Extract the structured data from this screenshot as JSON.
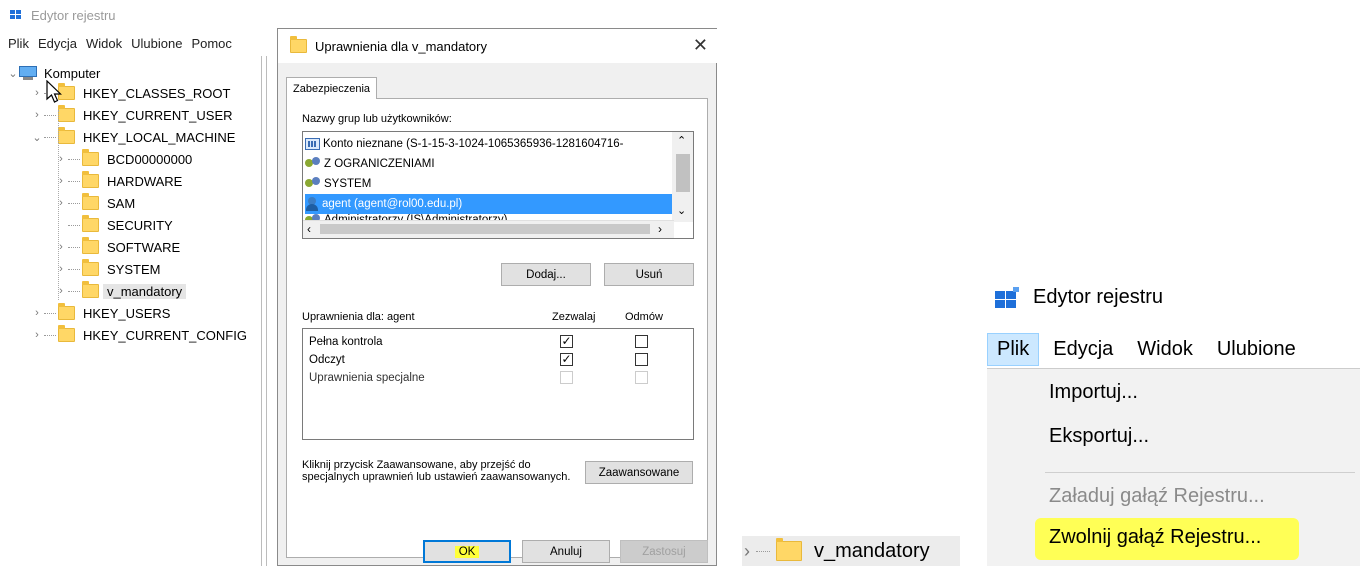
{
  "registry": {
    "title": "Edytor rejestru",
    "menu": [
      "Plik",
      "Edycja",
      "Widok",
      "Ulubione",
      "Pomoc"
    ],
    "tree": {
      "root": "Komputer",
      "items": [
        "HKEY_CLASSES_ROOT",
        "HKEY_CURRENT_USER",
        "HKEY_LOCAL_MACHINE",
        "BCD00000000",
        "HARDWARE",
        "SAM",
        "SECURITY",
        "SOFTWARE",
        "SYSTEM",
        "v_mandatory",
        "HKEY_USERS",
        "HKEY_CURRENT_CONFIG"
      ]
    }
  },
  "dialog": {
    "title": "Uprawnienia dla v_mandatory",
    "close_glyph": "✕",
    "tab": "Zabezpieczenia",
    "groups_label": "Nazwy grup lub użytkowników:",
    "groups": [
      "Konto nieznane (S-1-15-3-1024-1065365936-1281604716-",
      "Z OGRANICZENIAMI",
      "SYSTEM",
      "agent (agent@rol00.edu.pl)",
      "Administratorzy (IS\\Administratorzy)"
    ],
    "add": "Dodaj...",
    "remove": "Usuń",
    "perm_label": "Uprawnienia dla: agent",
    "allow": "Zezwalaj",
    "deny": "Odmów",
    "permissions": [
      {
        "name": "Pełna kontrola",
        "allow": true,
        "deny": false
      },
      {
        "name": "Odczyt",
        "allow": true,
        "deny": false
      },
      {
        "name": "Uprawnienia specjalne",
        "allow": false,
        "deny": false
      }
    ],
    "advanced_hint": "Kliknij przycisk Zaawansowane, aby przejść do specjalnych uprawnień lub ustawień zaawansowanych.",
    "advanced": "Zaawansowane",
    "ok": "OK",
    "cancel": "Anuluj",
    "apply": "Zastosuj"
  },
  "crop_node": {
    "label": "v_mandatory"
  },
  "file_menu": {
    "title": "Edytor rejestru",
    "menubar": [
      "Plik",
      "Edycja",
      "Widok",
      "Ulubione"
    ],
    "items": [
      "Importuj...",
      "Eksportuj...",
      "Załaduj gałąź Rejestru...",
      "Zwolnij gałąź Rejestru..."
    ]
  },
  "colors": {
    "selection": "#3399ff",
    "highlight": "#ffff3a",
    "menu_hover": "#cce8ff"
  }
}
